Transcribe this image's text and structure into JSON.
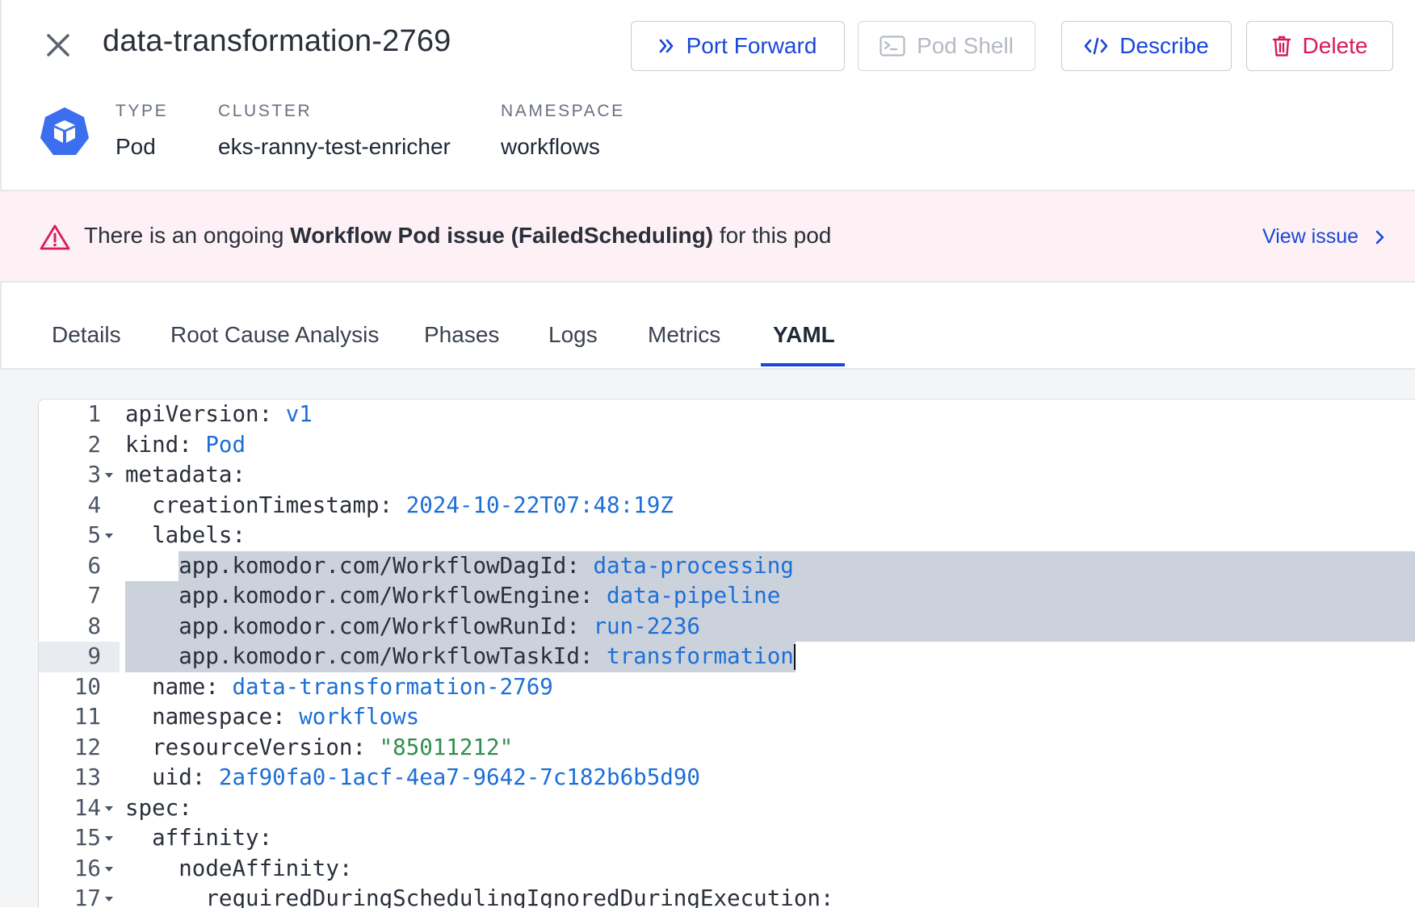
{
  "header": {
    "title": "data-transformation-2769",
    "buttons": {
      "port_forward": "Port Forward",
      "pod_shell": "Pod Shell",
      "describe": "Describe",
      "delete": "Delete"
    }
  },
  "meta": {
    "type_label": "TYPE",
    "type_value": "Pod",
    "cluster_label": "CLUSTER",
    "cluster_value": "eks-ranny-test-enricher",
    "namespace_label": "NAMESPACE",
    "namespace_value": "workflows"
  },
  "alert": {
    "prefix": "There is an ongoing ",
    "issue": "Workflow Pod issue (FailedScheduling)",
    "suffix": " for this pod",
    "link": "View issue"
  },
  "tabs": [
    "Details",
    "Root Cause Analysis",
    "Phases",
    "Logs",
    "Metrics",
    "YAML"
  ],
  "active_tab": "YAML",
  "yaml": {
    "lines": [
      {
        "n": "1",
        "indent": "",
        "key": "apiVersion: ",
        "val": "v1",
        "type": "v"
      },
      {
        "n": "2",
        "indent": "",
        "key": "kind: ",
        "val": "Pod",
        "type": "v"
      },
      {
        "n": "3",
        "indent": "",
        "key": "metadata:",
        "val": "",
        "type": "v"
      },
      {
        "n": "4",
        "indent": "  ",
        "key": "creationTimestamp: ",
        "val": "2024-10-22T07:48:19Z",
        "type": "v"
      },
      {
        "n": "5",
        "indent": "  ",
        "key": "labels:",
        "val": "",
        "type": "v"
      },
      {
        "n": "6",
        "indent": "    ",
        "key": "app.komodor.com/WorkflowDagId: ",
        "val": "data-processing",
        "type": "v"
      },
      {
        "n": "7",
        "indent": "    ",
        "key": "app.komodor.com/WorkflowEngine: ",
        "val": "data-pipeline",
        "type": "v"
      },
      {
        "n": "8",
        "indent": "    ",
        "key": "app.komodor.com/WorkflowRunId: ",
        "val": "run-2236",
        "type": "v"
      },
      {
        "n": "9",
        "indent": "    ",
        "key": "app.komodor.com/WorkflowTaskId: ",
        "val": "transformation",
        "type": "v"
      },
      {
        "n": "10",
        "indent": "  ",
        "key": "name: ",
        "val": "data-transformation-2769",
        "type": "v"
      },
      {
        "n": "11",
        "indent": "  ",
        "key": "namespace: ",
        "val": "workflows",
        "type": "v"
      },
      {
        "n": "12",
        "indent": "  ",
        "key": "resourceVersion: ",
        "val": "\"85011212\"",
        "type": "s"
      },
      {
        "n": "13",
        "indent": "  ",
        "key": "uid: ",
        "val": "2af90fa0-1acf-4ea7-9642-7c182b6b5d90",
        "type": "v"
      },
      {
        "n": "14",
        "indent": "",
        "key": "spec:",
        "val": "",
        "type": "v"
      },
      {
        "n": "15",
        "indent": "  ",
        "key": "affinity:",
        "val": "",
        "type": "v"
      },
      {
        "n": "16",
        "indent": "    ",
        "key": "nodeAffinity:",
        "val": "",
        "type": "v"
      },
      {
        "n": "17",
        "indent": "      ",
        "key": "requiredDuringSchedulingIgnoredDuringExecution:",
        "val": "",
        "type": "v"
      }
    ]
  },
  "colors": {
    "accent": "#1a47d9",
    "danger": "#d81b60",
    "yaml_value": "#1d6fd6",
    "yaml_string": "#2f8f4e",
    "alert_bg": "#fdf1f5",
    "pod_icon": "#3b6ff0"
  },
  "icons": {
    "close": "close-icon",
    "port_forward": "double-chevron-right-icon",
    "pod_shell": "terminal-icon",
    "describe": "code-icon",
    "delete": "trash-icon",
    "pod": "kubernetes-pod-icon",
    "alert": "warning-triangle-icon",
    "view_issue": "chevron-right-icon"
  }
}
